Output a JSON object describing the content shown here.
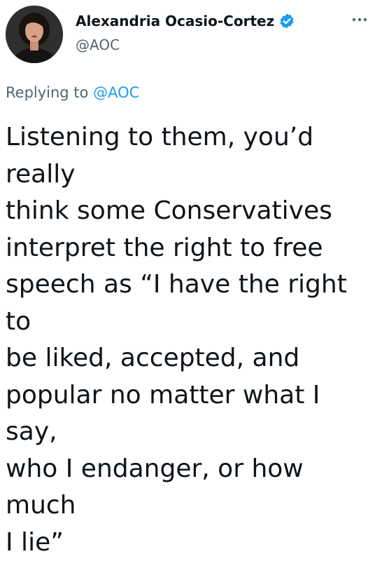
{
  "tweet": {
    "author": {
      "display_name": "Alexandria Ocasio-Cortez",
      "handle": "@AOC",
      "verified": true
    },
    "reply": {
      "prefix": "Replying to ",
      "target": "@AOC"
    },
    "text": "Listening to them, you’d really\nthink some Conservatives\ninterpret the right to free\nspeech as “I have the right to\nbe liked, accepted, and\npopular no matter what I say,\nwho I endanger, or how much\nI lie”"
  },
  "icons": {
    "verified": "verified-badge-icon",
    "more": "more-options-icon"
  },
  "colors": {
    "text": "#0f1419",
    "secondary": "#536471",
    "accent": "#1d9bf0"
  }
}
